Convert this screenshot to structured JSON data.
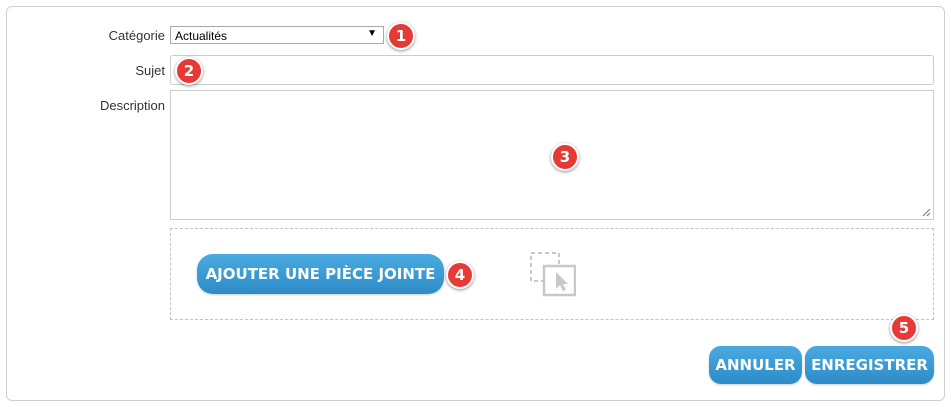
{
  "form": {
    "category_label": "Catégorie",
    "category_value": "Actualités",
    "subject_label": "Sujet",
    "subject_value": "",
    "description_label": "Description",
    "description_value": ""
  },
  "attachment": {
    "button_label": "AJOUTER UNE PIÈCE JOINTE",
    "drop_icon": "drag-drop-icon"
  },
  "actions": {
    "cancel_label": "ANNULER",
    "save_label": "ENREGISTRER"
  },
  "callouts": [
    "1",
    "2",
    "3",
    "4",
    "5"
  ],
  "colors": {
    "button": "#3a9ad4",
    "callout": "#e53a35"
  }
}
